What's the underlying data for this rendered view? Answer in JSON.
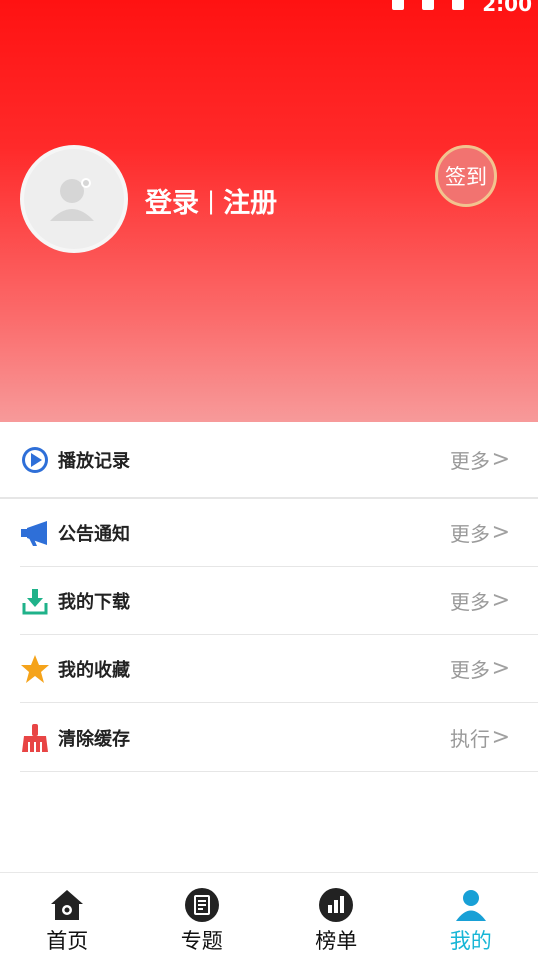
{
  "status_bar": {
    "time": "2:00"
  },
  "profile": {
    "login_text": "登录",
    "separator": "|",
    "register_text": "注册",
    "signin_label": "签到"
  },
  "menu": {
    "items": [
      {
        "label": "播放记录",
        "action": "更多",
        "icon": "play-circle-icon",
        "icon_color": "#2e6fd8"
      },
      {
        "label": "公告通知",
        "action": "更多",
        "icon": "megaphone-icon",
        "icon_color": "#2e6fd8"
      },
      {
        "label": "我的下载",
        "action": "更多",
        "icon": "download-tray-icon",
        "icon_color": "#1fb28a"
      },
      {
        "label": "我的收藏",
        "action": "更多",
        "icon": "star-icon",
        "icon_color": "#f5a31a"
      },
      {
        "label": "清除缓存",
        "action": "执行",
        "icon": "broom-icon",
        "icon_color": "#e84545"
      }
    ],
    "chevron": ">"
  },
  "tabbar": {
    "tabs": [
      {
        "label": "首页",
        "icon": "home-icon"
      },
      {
        "label": "专题",
        "icon": "topic-icon"
      },
      {
        "label": "榜单",
        "icon": "chart-icon"
      },
      {
        "label": "我的",
        "icon": "user-icon",
        "active": true
      }
    ],
    "active_color": "#18b6d6"
  }
}
